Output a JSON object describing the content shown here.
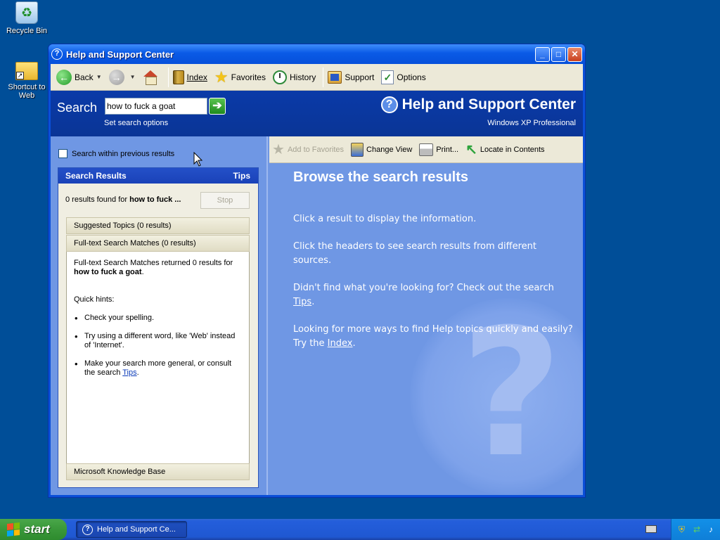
{
  "desktop": {
    "icons": [
      {
        "label": "Recycle Bin"
      },
      {
        "label": "Shortcut to Web"
      }
    ]
  },
  "window": {
    "title": "Help and Support Center"
  },
  "toolbar": {
    "back": "Back",
    "index": "Index",
    "favorites": "Favorites",
    "history": "History",
    "support": "Support",
    "options": "Options"
  },
  "search": {
    "label": "Search",
    "query": "how to fuck a goat",
    "set_options": "Set search options",
    "brand_title": "Help and Support Center",
    "edition": "Windows XP Professional"
  },
  "left": {
    "within_previous": "Search within previous results",
    "results_header": "Search Results",
    "tips_label": "Tips",
    "count_prefix": "0 results found for ",
    "count_query": "how to fuck ...",
    "stop_label": "Stop",
    "suggested": "Suggested Topics (0 results)",
    "fulltext": "Full-text Search Matches (0 results)",
    "body_line1": "Full-text Search Matches returned 0 results for",
    "body_query": "how to fuck a goat",
    "body_period": ".",
    "quick_hints": "Quick hints:",
    "hint1": "Check your spelling.",
    "hint2": "Try using a different word, like 'Web' instead of 'Internet'.",
    "hint3_prefix": "Make your search more general, or consult the search ",
    "hint3_link": "Tips",
    "hint3_suffix": ".",
    "kb": "Microsoft Knowledge Base"
  },
  "right": {
    "toolbar": {
      "add_favorites": "Add to Favorites",
      "change_view": "Change View",
      "print": "Print...",
      "locate": "Locate in Contents"
    },
    "heading": "Browse the search results",
    "p1": "Click a result to display the information.",
    "p2": "Click the headers to see search results from different sources.",
    "p3_prefix": "Didn't find what you're looking for? Check out the search ",
    "p3_link": "Tips",
    "p3_suffix": ".",
    "p4_prefix": "Looking for more ways to find Help topics quickly and easily? Try the ",
    "p4_link": "Index",
    "p4_suffix": "."
  },
  "taskbar": {
    "start": "start",
    "task": "Help and Support Ce..."
  },
  "colors": {
    "desktop": "#004e98",
    "pane_blue": "#6f97e4",
    "band_blue": "#0a3aa8"
  }
}
